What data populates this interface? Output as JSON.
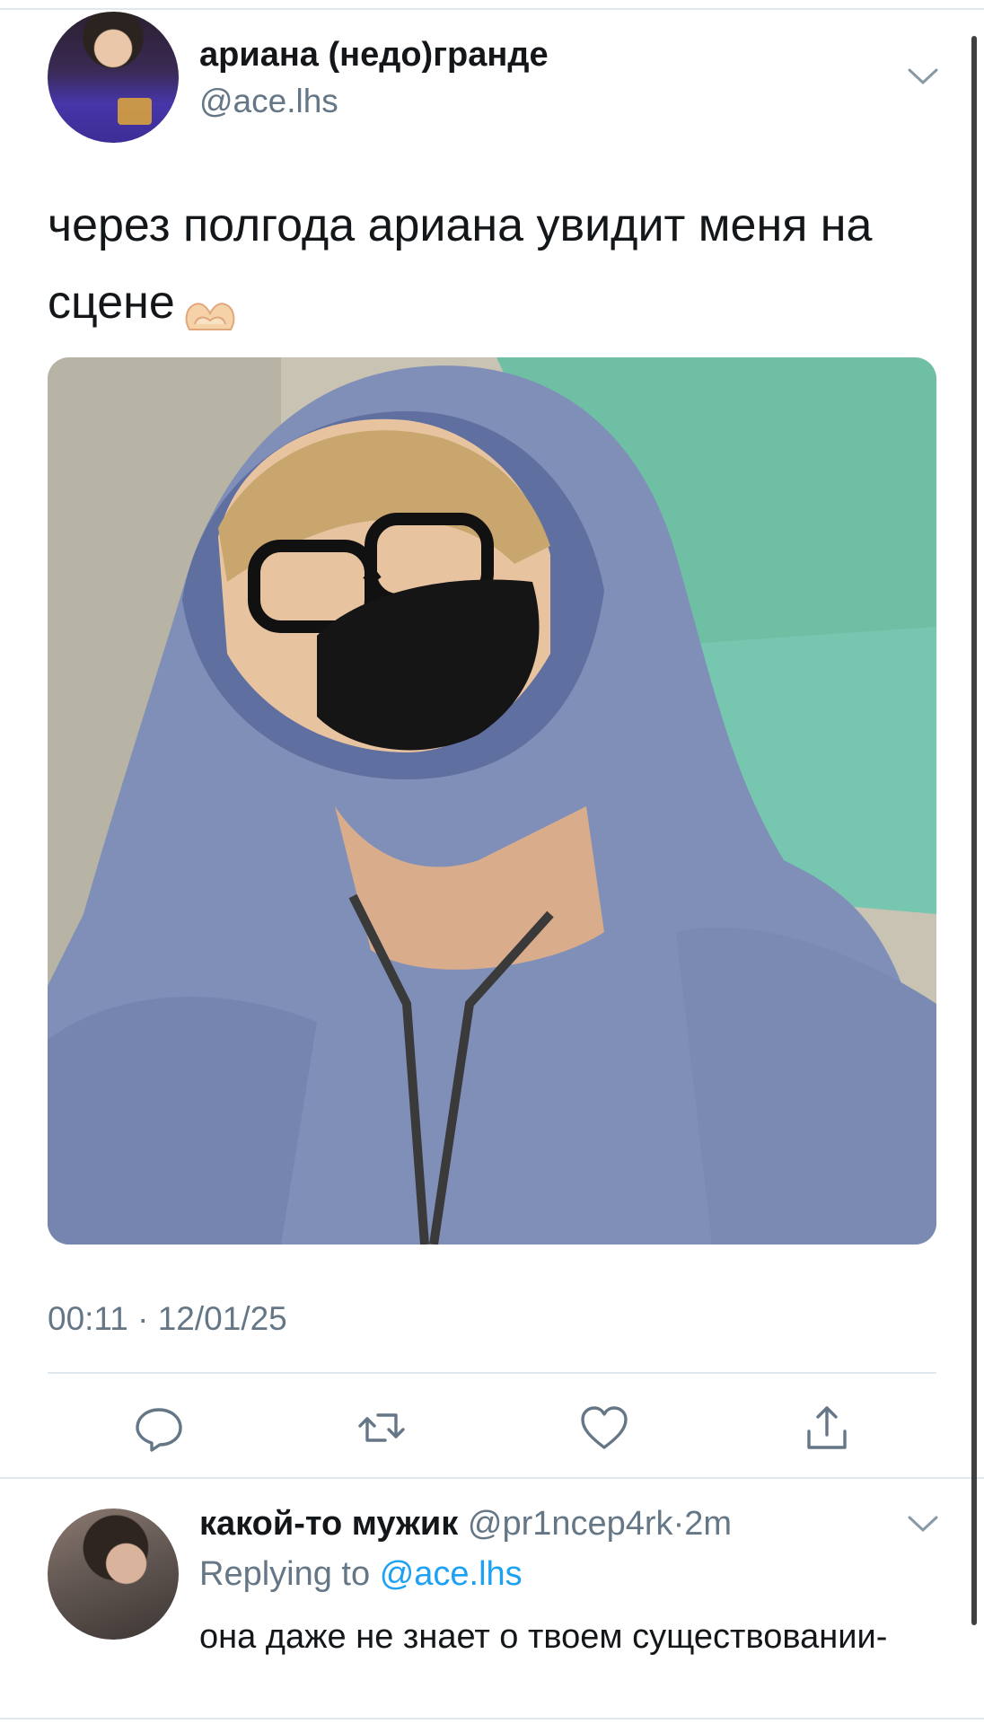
{
  "tweet": {
    "author": {
      "display_name": "ариана (недо)гранде",
      "handle": "@ace.lhs",
      "avatar": "avatar-photo"
    },
    "text": "через полгода ариана увидит меня на сцене",
    "emoji": "heart-hands-emoji",
    "media_description": "selfie photo",
    "timestamp": "00:11 · 12/01/25",
    "actions": [
      "reply-icon",
      "retweet-icon",
      "like-icon",
      "share-icon"
    ],
    "menu_icon": "chevron-down-icon"
  },
  "reply": {
    "display_name": "какой-то мужик",
    "handle": "@pr1ncep4rk",
    "separator": "·",
    "time": "2m",
    "replying_prefix": "Replying to",
    "replying_mention": "@ace.lhs",
    "text": "она даже не знает о твоем существовании-",
    "menu_icon": "chevron-down-icon"
  },
  "colors": {
    "text": "#14171a",
    "secondary": "#657786",
    "link": "#1da1f2",
    "divider": "#e1e8ed"
  }
}
